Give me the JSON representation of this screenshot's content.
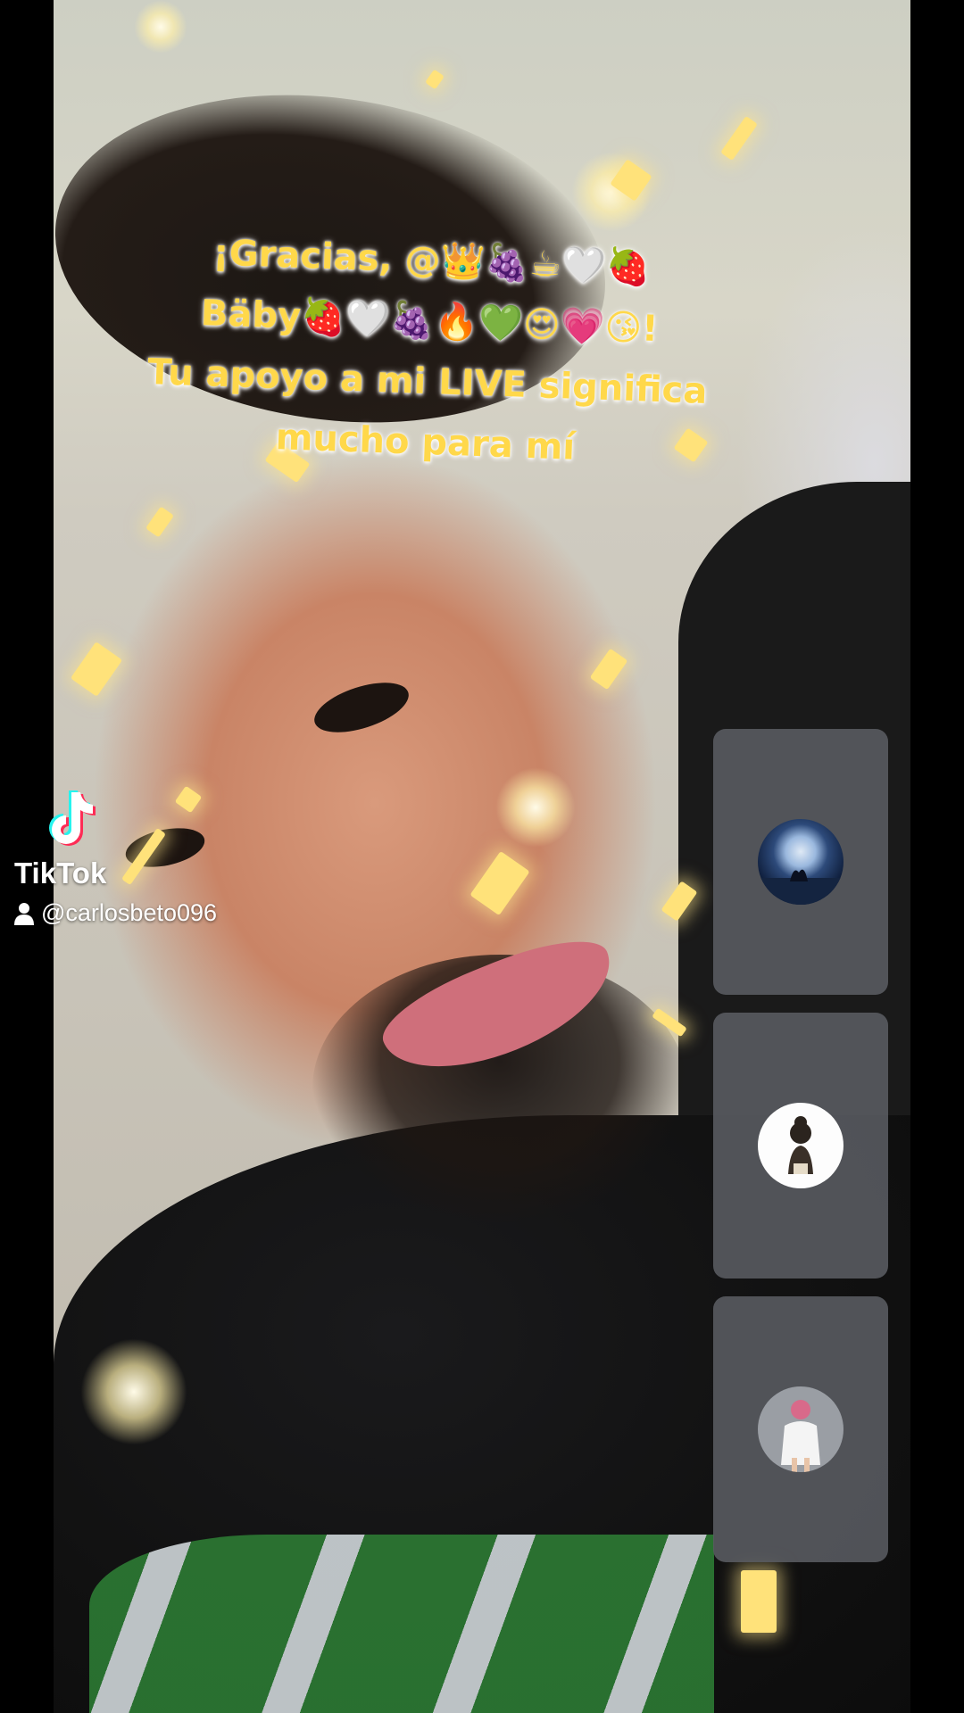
{
  "overlay": {
    "caption_lines": [
      "¡Gracias, @👑🍇☕🤍🍓",
      "Bäby🍓🤍🍇🔥💚😍💗😘!",
      "Tu apoyo a mi LIVE significa",
      "mucho para mí"
    ],
    "caption_color": "#ffd84a"
  },
  "side_panels": [
    {
      "avatar": "moon-couple-avatar"
    },
    {
      "avatar": "girl-avatar"
    },
    {
      "avatar": "girl-white-shirt-avatar"
    }
  ],
  "watermark": {
    "brand": "TikTok",
    "handle": "@carlosbeto096",
    "icon": "tiktok-logo-icon",
    "user_icon": "user-icon"
  }
}
